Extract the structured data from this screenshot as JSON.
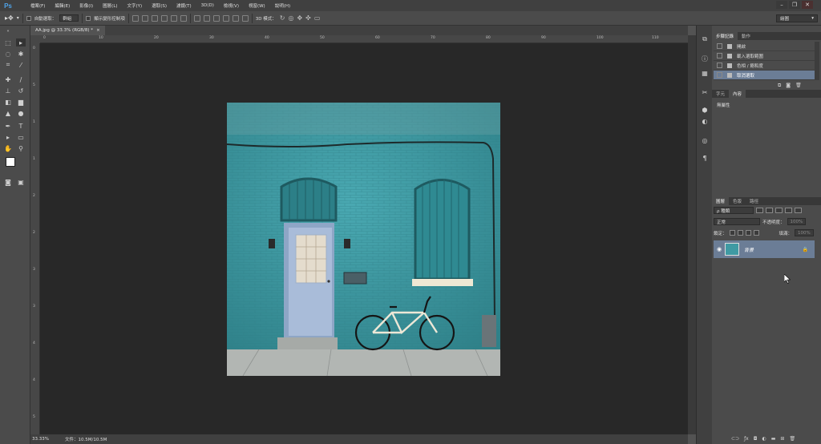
{
  "app": {
    "logo": "Ps"
  },
  "menu": [
    "檔案(F)",
    "編輯(E)",
    "影像(I)",
    "圖層(L)",
    "文字(Y)",
    "選取(S)",
    "濾鏡(T)",
    "3D(D)",
    "檢視(V)",
    "視窗(W)",
    "說明(H)"
  ],
  "window_controls": [
    "–",
    "❐",
    "✕"
  ],
  "options": {
    "auto_select_label": "自動選取：",
    "auto_select_value": "群組",
    "show_transform_label": "顯示變形控制項",
    "mode_3d_label": "3D 模式：",
    "workspace": "繪圖"
  },
  "document": {
    "tab_title": "AA.jpg @ 33.3% (RGB/8) *",
    "close": "×",
    "zoom": "33.33%",
    "file_info": "文件：10.5M/10.5M"
  },
  "rulers": {
    "h": [
      "0",
      "10",
      "20",
      "30",
      "40",
      "50",
      "60",
      "70",
      "80",
      "90",
      "100",
      "110"
    ],
    "v": [
      "0",
      "5",
      "1",
      "1",
      "2",
      "2",
      "3",
      "3",
      "4",
      "4",
      "5"
    ]
  },
  "panels": {
    "history_tabs": [
      "步驟記錄",
      "動作"
    ],
    "history": [
      "開啟",
      "載入選取範圍",
      "色相 / 飽和度",
      "取消選取"
    ],
    "props_tabs": [
      "字元",
      "內容"
    ],
    "props_text": "無屬性",
    "layer_tabs": [
      "圖層",
      "色版",
      "路徑"
    ],
    "kind": "ρ 種類",
    "blend": "正常",
    "opacity_label": "不透明度：",
    "opacity_value": "100%",
    "lock_label": "鎖定：",
    "fill_label": "填滿：",
    "fill_value": "100%",
    "layer_name": "背景"
  },
  "colors": {
    "wall": "#3f9aa3",
    "door": "#a7bbd8",
    "selection": "#6b7d96"
  }
}
